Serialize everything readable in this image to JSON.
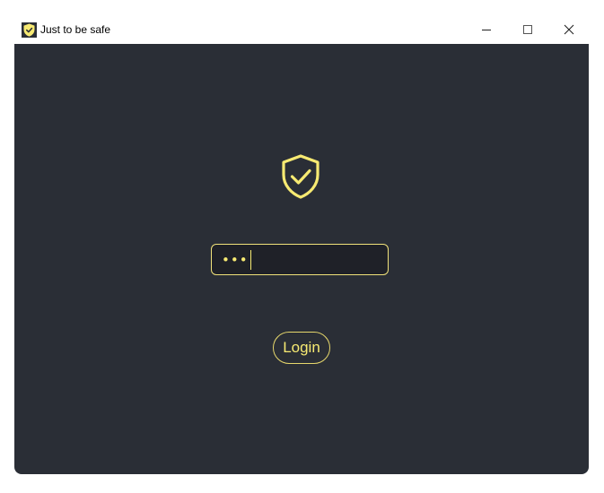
{
  "window": {
    "title": "Just to be safe",
    "controls": {
      "minimize_icon": "minimize-icon",
      "maximize_icon": "maximize-icon",
      "close_icon": "close-icon"
    }
  },
  "login": {
    "password_value": "•••",
    "button_label": "Login"
  },
  "colors": {
    "background": "#2a2e36",
    "accent": "#f7ea72",
    "field_background": "#1f2128",
    "titlebar": "#ffffff"
  },
  "icons": {
    "app_icon": "shield-check-icon",
    "main_icon": "shield-check-icon"
  }
}
